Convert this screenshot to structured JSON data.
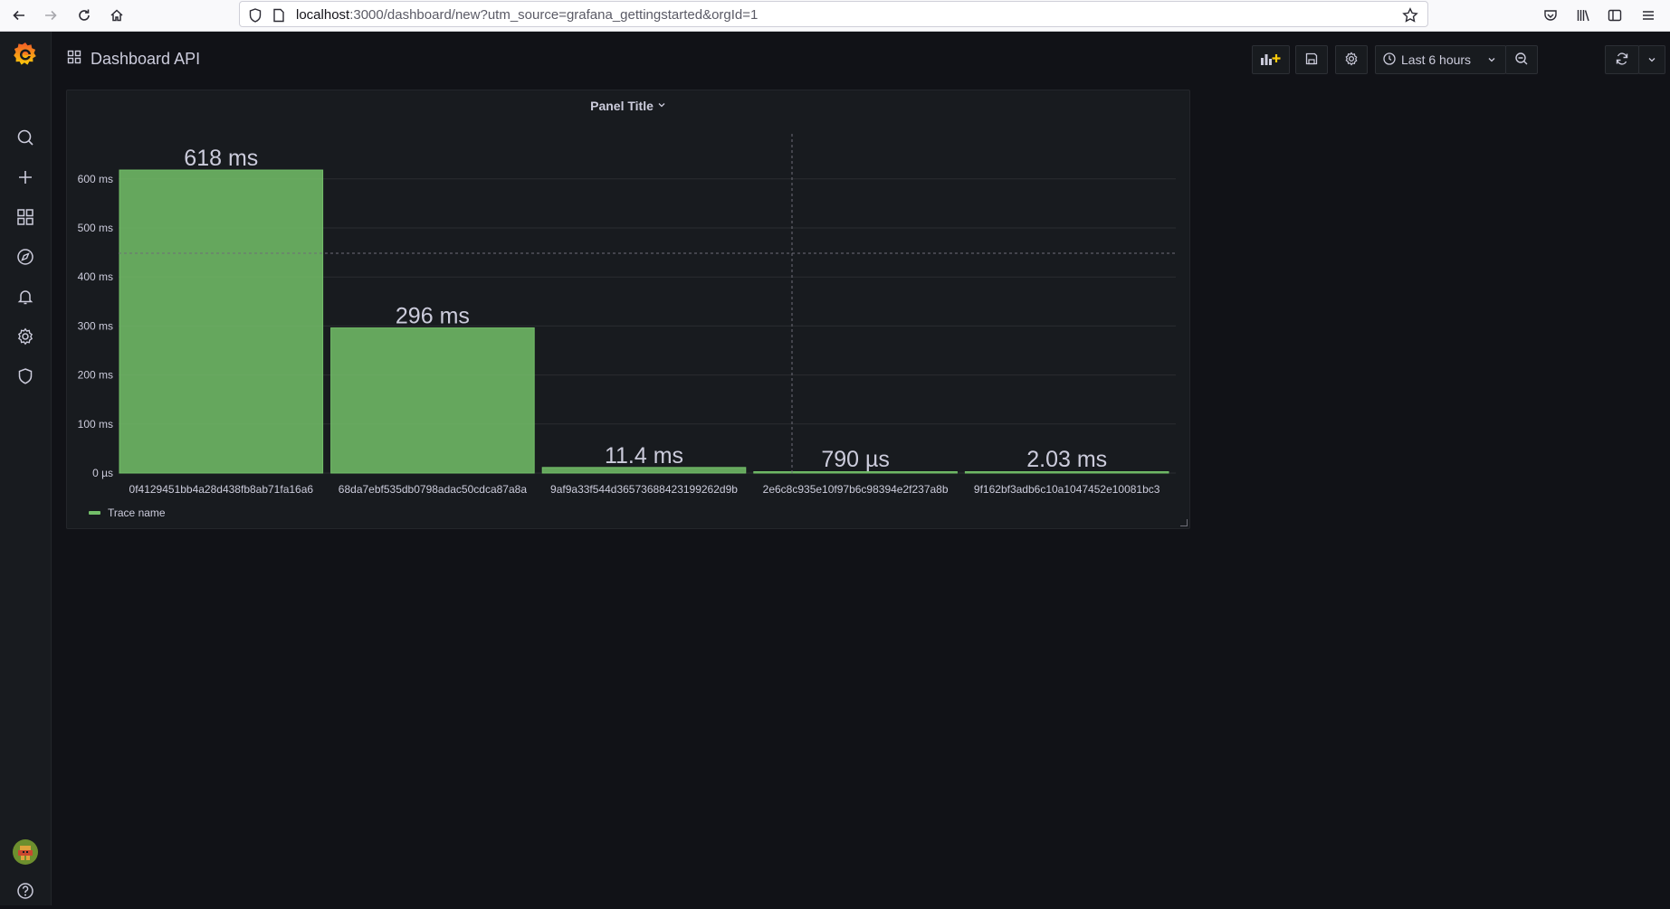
{
  "browser": {
    "url_host": "localhost",
    "url_rest": ":3000/dashboard/new?utm_source=grafana_gettingstarted&orgId=1"
  },
  "dashboard": {
    "title": "Dashboard API"
  },
  "toolbar": {
    "time_range_label": "Last 6 hours"
  },
  "panel": {
    "title": "Panel Title"
  },
  "chart_data": {
    "type": "bar",
    "title": "Panel Title",
    "categories": [
      "0f4129451bb4a28d438fb8ab71fa16a6",
      "68da7ebf535db0798adac50cdca87a8a",
      "9af9a33f544d36573688423199262d9b",
      "2e6c8c935e10f97b6c98394e2f237a8b",
      "9f162bf3adb6c10a1047452e10081bc3"
    ],
    "series": [
      {
        "name": "Trace name",
        "values_ms": [
          618,
          296,
          11.4,
          0.79,
          2.03
        ],
        "value_labels": [
          "618 ms",
          "296 ms",
          "11.4 ms",
          "790 µs",
          "2.03 ms"
        ],
        "color": "#73bf69"
      }
    ],
    "y_ticks": [
      "0 µs",
      "100 ms",
      "200 ms",
      "300 ms",
      "400 ms",
      "500 ms",
      "600 ms"
    ],
    "y_tick_values": [
      0,
      100,
      200,
      300,
      400,
      500,
      600
    ],
    "ylim": [
      0,
      690
    ],
    "legend_position": "bottom-left",
    "grid": true
  }
}
